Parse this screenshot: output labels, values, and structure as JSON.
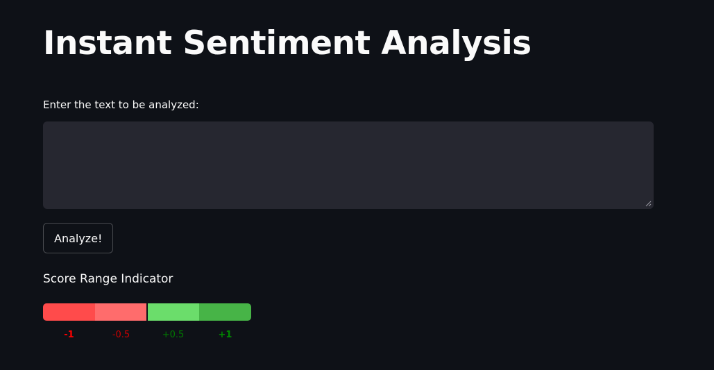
{
  "page": {
    "title": "Instant Sentiment Analysis"
  },
  "input": {
    "label": "Enter the text to be analyzed:",
    "value": "",
    "placeholder": ""
  },
  "analyze_button": {
    "label": "Analyze!"
  },
  "score_indicator": {
    "label": "Score Range Indicator",
    "segments": [
      {
        "color": "#ff4b4b"
      },
      {
        "color": "#ff6c6c"
      },
      {
        "color": "#6bdd6b"
      },
      {
        "color": "#47b447"
      }
    ],
    "ticks": [
      {
        "text": "-1",
        "color": "#ff0000",
        "bold": true
      },
      {
        "text": "-0.5",
        "color": "#cc0000",
        "bold": false
      },
      {
        "text": "+0.5",
        "color": "#007a00",
        "bold": false
      },
      {
        "text": "+1",
        "color": "#008800",
        "bold": true
      }
    ]
  },
  "colors": {
    "background": "#0e1117",
    "input_background": "#262730",
    "text": "#fafafa"
  }
}
